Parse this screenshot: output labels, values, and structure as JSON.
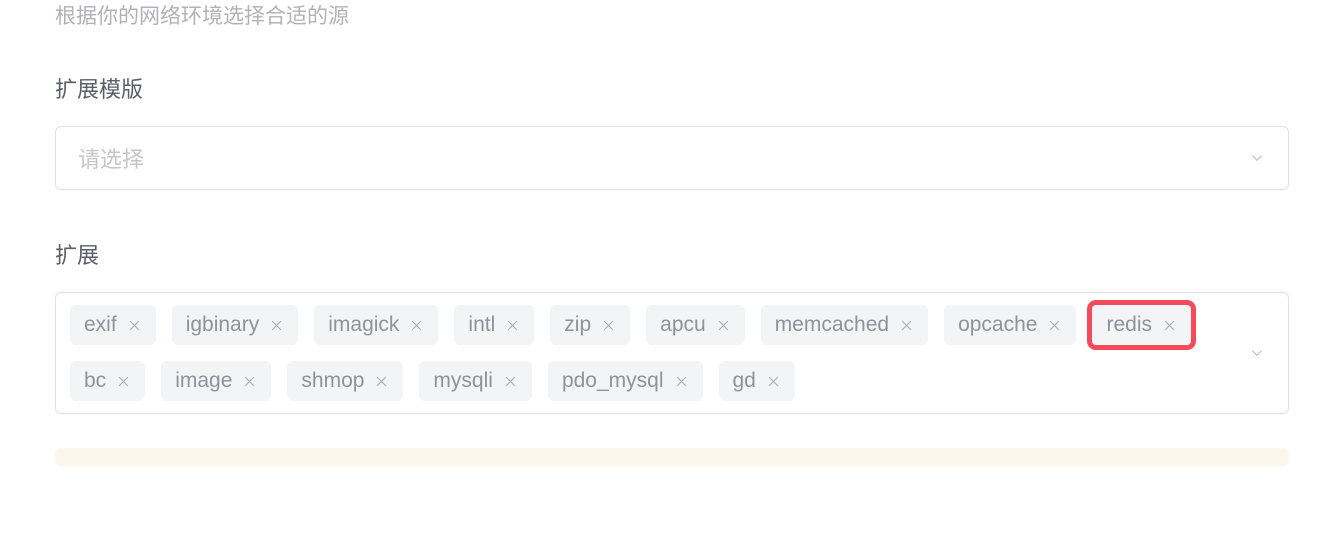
{
  "helper_text": "根据你的网络环境选择合适的源",
  "sections": {
    "template": {
      "label": "扩展模版",
      "placeholder": "请选择"
    },
    "extensions": {
      "label": "扩展",
      "tags": [
        {
          "name": "exif",
          "highlighted": false
        },
        {
          "name": "igbinary",
          "highlighted": false
        },
        {
          "name": "imagick",
          "highlighted": false
        },
        {
          "name": "intl",
          "highlighted": false
        },
        {
          "name": "zip",
          "highlighted": false
        },
        {
          "name": "apcu",
          "highlighted": false
        },
        {
          "name": "memcached",
          "highlighted": false
        },
        {
          "name": "opcache",
          "highlighted": false
        },
        {
          "name": "redis",
          "highlighted": true
        },
        {
          "name": "bc",
          "highlighted": false
        },
        {
          "name": "image",
          "highlighted": false
        },
        {
          "name": "shmop",
          "highlighted": false
        },
        {
          "name": "mysqli",
          "highlighted": false
        },
        {
          "name": "pdo_mysql",
          "highlighted": false
        },
        {
          "name": "gd",
          "highlighted": false
        }
      ]
    }
  }
}
